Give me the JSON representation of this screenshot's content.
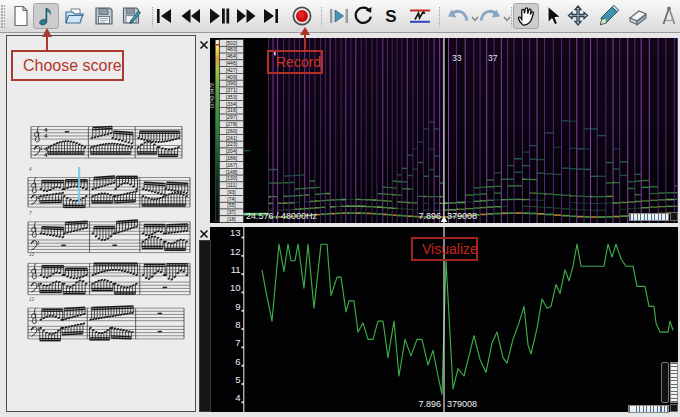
{
  "colors": {
    "accent_red": "#b2372c",
    "annotation_red_on_dark": "#cc2318",
    "spectro_line_purple": "#6f3494",
    "trace_green": "#3fae4a",
    "chart_green": "#3cae46",
    "playhead_white": "#f2f2f2"
  },
  "toolbar": {
    "buttons": [
      {
        "name": "new-session",
        "icon": "document-icon"
      },
      {
        "name": "choose-score",
        "icon": "music-note-icon",
        "pressed": true
      },
      {
        "name": "open",
        "icon": "open-folder-icon"
      },
      {
        "name": "save-session",
        "icon": "floppy-disk-icon"
      },
      {
        "name": "save-session-as",
        "icon": "floppy-pencil-icon"
      },
      {
        "name": "rewind-to-start",
        "icon": "skip-start-icon"
      },
      {
        "name": "rewind",
        "icon": "rewind-icon"
      },
      {
        "name": "play-pause",
        "icon": "play-pause-icon"
      },
      {
        "name": "fast-forward",
        "icon": "fast-forward-icon"
      },
      {
        "name": "fast-forward-to-end",
        "icon": "skip-end-icon"
      },
      {
        "name": "record",
        "icon": "record-icon"
      },
      {
        "name": "play-selection",
        "icon": "play-selection-icon"
      },
      {
        "name": "loop-playback",
        "icon": "loop-icon"
      },
      {
        "name": "solo",
        "icon": "solo-s-icon"
      },
      {
        "name": "align",
        "icon": "align-icon"
      },
      {
        "name": "undo",
        "icon": "undo-arrow-icon"
      },
      {
        "name": "redo",
        "icon": "redo-arrow-icon"
      },
      {
        "name": "navigate-tool",
        "icon": "hand-icon",
        "pressed": true
      },
      {
        "name": "select-tool",
        "icon": "cursor-arrow-icon"
      },
      {
        "name": "edit-tool",
        "icon": "move-cross-icon"
      },
      {
        "name": "draw-tool",
        "icon": "pencil-icon"
      },
      {
        "name": "erase-tool",
        "icon": "eraser-icon"
      },
      {
        "name": "measure-tool",
        "icon": "compass-icon"
      }
    ]
  },
  "annotations": {
    "choose_score": "Choose score",
    "record": "Record",
    "visualize": "Visualize"
  },
  "spectrogram_pane": {
    "close_icon": "x",
    "scale_label": "0/743.9478",
    "bin_labels": [
      "[502]",
      "[483]",
      "[464]",
      "[446]",
      "[427]",
      "[409]",
      "[390]",
      "[371]",
      "[353]",
      "[334]",
      "[316]",
      "[297]",
      "[278]",
      "[260]",
      "[241]",
      "[223]",
      "[204]",
      "[186]",
      "[167]",
      "[148]",
      "[130]",
      "[111]",
      "[93]",
      "[74]",
      "[55]",
      "[37]",
      "[18]"
    ],
    "overlay_numbers": [
      {
        "text": "33",
        "x": 452
      },
      {
        "text": "37",
        "x": 488
      }
    ],
    "status_left": "24.576 / 48000Hz",
    "playhead_time": "7.896",
    "playhead_frame": "379008"
  },
  "melody_pane": {
    "close_icon": "x",
    "y_ticks": [
      13,
      12,
      11,
      10,
      9,
      8,
      7,
      6,
      5,
      4
    ],
    "playhead_time": "7.896",
    "playhead_frame": "379008"
  },
  "chart_data": [
    {
      "type": "line",
      "title": "",
      "xlabel": "",
      "ylabel": "",
      "ylim": [
        4,
        13
      ],
      "y_ticks": [
        4,
        5,
        6,
        7,
        8,
        9,
        10,
        11,
        12,
        13
      ],
      "legend": null,
      "grid": false,
      "x_unit": "screen_px",
      "points": [
        [
          262,
          11.0
        ],
        [
          266,
          9.8
        ],
        [
          272,
          8.2
        ],
        [
          279,
          12.4
        ],
        [
          284,
          10.9
        ],
        [
          288,
          12.4
        ],
        [
          291,
          11.5
        ],
        [
          295,
          11.5
        ],
        [
          298,
          12.4
        ],
        [
          304,
          10.0
        ],
        [
          308,
          12.4
        ],
        [
          314,
          8.9
        ],
        [
          321,
          12.4
        ],
        [
          327,
          12.4
        ],
        [
          331,
          9.6
        ],
        [
          337,
          10.6
        ],
        [
          341,
          10.6
        ],
        [
          346,
          8.7
        ],
        [
          349,
          9.3
        ],
        [
          354,
          9.3
        ],
        [
          358,
          7.6
        ],
        [
          363,
          8.1
        ],
        [
          368,
          7.2
        ],
        [
          373,
          7.2
        ],
        [
          378,
          8.2
        ],
        [
          383,
          8.2
        ],
        [
          388,
          6.2
        ],
        [
          394,
          8.2
        ],
        [
          399,
          5.2
        ],
        [
          405,
          7.2
        ],
        [
          411,
          6.3
        ],
        [
          417,
          7.2
        ],
        [
          422,
          7.2
        ],
        [
          428,
          5.8
        ],
        [
          433,
          6.6
        ],
        [
          438,
          5.2
        ],
        [
          442,
          4.2
        ],
        [
          446,
          11.5
        ],
        [
          453,
          4.5
        ],
        [
          458,
          5.6
        ],
        [
          464,
          5.2
        ],
        [
          474,
          7.4
        ],
        [
          480,
          6.1
        ],
        [
          486,
          5.4
        ],
        [
          492,
          7.0
        ],
        [
          497,
          7.6
        ],
        [
          503,
          6.2
        ],
        [
          507,
          5.9
        ],
        [
          513,
          7.2
        ],
        [
          519,
          8.1
        ],
        [
          524,
          9.0
        ],
        [
          528,
          6.9
        ],
        [
          531,
          6.4
        ],
        [
          537,
          7.8
        ],
        [
          542,
          9.4
        ],
        [
          547,
          8.9
        ],
        [
          551,
          9.0
        ],
        [
          556,
          10.2
        ],
        [
          560,
          9.7
        ],
        [
          565,
          11.0
        ],
        [
          569,
          10.4
        ],
        [
          573,
          11.2
        ],
        [
          577,
          12.4
        ],
        [
          581,
          11.2
        ],
        [
          598,
          11.2
        ],
        [
          604,
          11.2
        ],
        [
          608,
          12.4
        ],
        [
          612,
          11.7
        ],
        [
          616,
          12.4
        ],
        [
          621,
          11.6
        ],
        [
          626,
          11.2
        ],
        [
          633,
          11.2
        ],
        [
          637,
          10.1
        ],
        [
          645,
          10.1
        ],
        [
          649,
          9.0
        ],
        [
          654,
          9.0
        ],
        [
          656,
          8.1
        ],
        [
          660,
          7.6
        ],
        [
          668,
          7.6
        ],
        [
          670,
          8.2
        ],
        [
          673,
          7.7
        ]
      ],
      "line_color": "#3cae46",
      "background": "#020204"
    },
    {
      "type": "heatmap",
      "subtype": "spectrogram",
      "description": "dB-coloured spectrogram with purple note-onset lines and green harmonic traces rising and falling in two arcs",
      "colour_scale_label": "0/743.9478",
      "frequency_bin_labels": [
        502,
        483,
        464,
        446,
        427,
        409,
        390,
        371,
        353,
        334,
        316,
        297,
        278,
        260,
        241,
        223,
        204,
        186,
        167,
        148,
        130,
        111,
        93,
        74,
        55,
        37,
        18
      ],
      "status": "24.576 / 48000Hz",
      "playhead": {
        "time_s": 7.896,
        "frame": 379008
      }
    }
  ]
}
